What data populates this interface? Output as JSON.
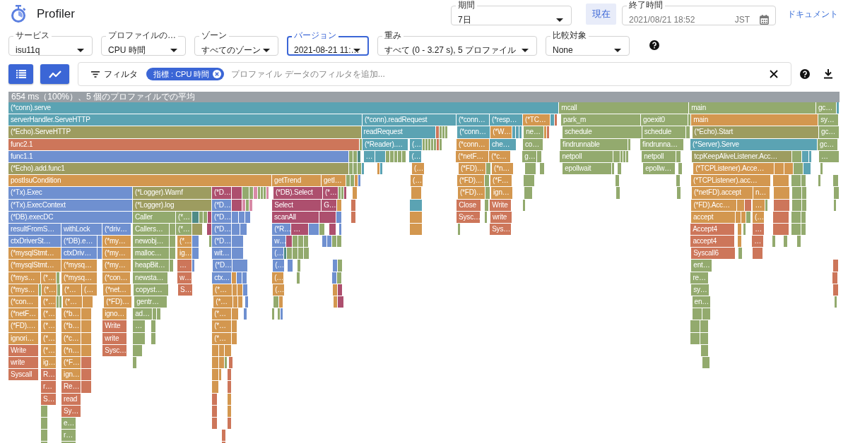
{
  "header": {
    "title": "Profiler",
    "period": {
      "label": "期間",
      "value": "7日"
    },
    "now_button": "現在",
    "end_time": {
      "label": "終了時間",
      "value": "2021/08/21 18:52",
      "timezone": "JST"
    },
    "docs_link": "ドキュメント"
  },
  "selectors": [
    {
      "label": "サービス",
      "value": "isu11q",
      "focused": false
    },
    {
      "label": "プロファイルの…",
      "value": "CPU 時間",
      "focused": false
    },
    {
      "label": "ゾーン",
      "value": "すべてのゾーン",
      "focused": false
    },
    {
      "label": "バージョン",
      "value": "2021-08-21 11:…",
      "focused": true
    },
    {
      "label": "重み",
      "value": "すべて (0 - 3.27 s), 5 プロファイル",
      "focused": false
    },
    {
      "label": "比較対象",
      "value": "None",
      "focused": false
    }
  ],
  "view_buttons": [
    {
      "kind": "list"
    },
    {
      "kind": "chart"
    }
  ],
  "filter_bar": {
    "label": "フィルタ",
    "chips": [
      {
        "text": "指標 : CPU 時間"
      }
    ],
    "placeholder": "プロファイル データのフィルタを追加..."
  },
  "flame_graph": {
    "summary": "654 ms（100%）、5 個のプロファイルでの平均",
    "rows": [
      {
        "frames": [
          {
            "label": "(*conn).serve",
            "color": "#5ba3b3"
          },
          {
            "label": "mcall",
            "color": "#93aa6e"
          },
          {
            "label": "main",
            "color": "#93aa6e"
          },
          {
            "label": "gc…",
            "color": "#93aa6e"
          },
          {
            "color": "#5ba3b3"
          }
        ]
      },
      {
        "frames": [
          {
            "label": "serverHandler.ServeHTTP",
            "color": "#5ba3b3"
          },
          {
            "label": "(*conn).readRequest",
            "color": "#5ba3b3"
          },
          {
            "label": "(*conn…",
            "color": "#5ba3b3"
          },
          {
            "label": "(*resp…",
            "color": "#5ba3b3"
          },
          {
            "label": "(*TC…",
            "color": "#d3974f"
          },
          {
            "color": "#5ba3b3"
          },
          {
            "color": "#cd765a"
          },
          {
            "label": "park_m",
            "color": "#93aa6e"
          },
          {
            "label": "goexit0",
            "color": "#93aa6e"
          },
          {
            "color": "#93aa6e"
          },
          {
            "label": "main",
            "color": "#d3974f"
          },
          {
            "label": "sy…",
            "color": "#93aa6e"
          }
        ]
      },
      {
        "frames": [
          {
            "label": "(*Echo).ServeHTTP",
            "color": "#9d9c60"
          },
          {
            "label": "readRequest",
            "color": "#5ba3b3"
          },
          {
            "color": "#cd765a"
          },
          {
            "color": "#93aa6e"
          },
          {
            "color": "#93aa6e"
          },
          {
            "color": "#93aa6e"
          },
          {
            "label": "(*conn…",
            "color": "#5ba3b3"
          },
          {
            "label": "(*W…",
            "color": "#d3974f"
          },
          {
            "color": "#5ba3b3"
          },
          {
            "color": "#5ba3b3"
          },
          {
            "color": "#5ba3b3"
          },
          {
            "label": "ne…",
            "color": "#93aa6e"
          },
          {
            "color": "#d3974f"
          },
          {
            "color": "#cd765a"
          },
          {
            "label": "schedule",
            "color": "#93aa6e"
          },
          {
            "label": "schedule",
            "color": "#93aa6e"
          },
          {
            "color": "#93aa6e"
          },
          {
            "label": "(*Echo).Start",
            "color": "#9d9c60"
          },
          {
            "label": "gc…",
            "color": "#93aa6e"
          }
        ]
      },
      {
        "frames": [
          {
            "label": "func2.1",
            "color": "#cd765a"
          },
          {
            "color": "#93aa6e"
          },
          {
            "label": "(*Reader).…",
            "color": "#5ba3b3"
          },
          {
            "label": "(…",
            "color": "#5ba3b3"
          },
          {
            "color": "#93aa6e"
          },
          {
            "color": "#93aa6e"
          },
          {
            "color": "#93aa6e"
          },
          {
            "color": "#93aa6e"
          },
          {
            "color": "#93aa6e"
          },
          {
            "color": "#cd765a"
          },
          {
            "color": "#93aa6e"
          },
          {
            "label": "(*conn…",
            "color": "#d3974f"
          },
          {
            "label": "che…",
            "color": "#5ba3b3"
          },
          {
            "label": "co…",
            "color": "#93aa6e"
          },
          {
            "label": "findrunnable",
            "color": "#93aa6e"
          },
          {
            "color": "#93aa6e"
          },
          {
            "label": "findrunna…",
            "color": "#93aa6e"
          },
          {
            "label": "(*Server).Serve",
            "color": "#5ba3b3"
          },
          {
            "label": "gc…",
            "color": "#93aa6e"
          }
        ]
      },
      {
        "frames": [
          {
            "label": "func1.1",
            "color": "#6f90d0"
          },
          {
            "color": "#93aa6e"
          },
          {
            "color": "#93aa6e"
          },
          {
            "color": "#4f8b86"
          },
          {
            "label": "…",
            "color": "#5ba3b3"
          },
          {
            "color": "#5ba3b3"
          },
          {
            "color": "#93aa6e"
          },
          {
            "color": "#93aa6e"
          },
          {
            "color": "#93aa6e"
          },
          {
            "color": "#93aa6e"
          },
          {
            "color": "#93aa6e"
          },
          {
            "label": "(…",
            "color": "#5ba3b3"
          },
          {
            "label": "(*netF…",
            "color": "#d3974f"
          },
          {
            "label": "(*c…",
            "color": "#d3974f"
          },
          {
            "label": "g…",
            "color": "#93aa6e"
          },
          {
            "color": "#93aa6e"
          },
          {
            "label": "netpoll",
            "color": "#93aa6e"
          },
          {
            "color": "#93aa6e"
          },
          {
            "color": "#93aa6e"
          },
          {
            "color": "#93aa6e"
          },
          {
            "color": "#93aa6e"
          },
          {
            "label": "netpoll",
            "color": "#93aa6e"
          },
          {
            "color": "#93aa6e"
          },
          {
            "label": "tcpKeepAliveListener.Acc…",
            "color": "#9d9c60"
          },
          {
            "color": "#93aa6e"
          },
          {
            "color": "#5ba3b3"
          },
          {
            "color": "#5ba3b3"
          },
          {
            "label": "…",
            "color": "#93aa6e"
          }
        ]
      },
      {
        "frames": [
          {
            "label": "(*Echo).add.func1",
            "color": "#9d9c60"
          },
          {
            "color": "#93aa6e"
          },
          {
            "color": "#93aa6e"
          },
          {
            "color": "#93aa6e"
          },
          {
            "color": "#5ba3b3"
          },
          {
            "color": "#d3974f"
          },
          {
            "color": "#5ba3b3"
          },
          {
            "label": "(…",
            "color": "#d3974f"
          },
          {
            "label": "(*FD)…",
            "color": "#d3974f"
          },
          {
            "color": "#93aa6e"
          },
          {
            "label": "(*n…",
            "color": "#d3974f"
          },
          {
            "color": "#93aa6e"
          },
          {
            "color": "#93aa6e"
          },
          {
            "label": "epollwait",
            "color": "#93aa6e"
          },
          {
            "color": "#93aa6e"
          },
          {
            "color": "#93aa6e"
          },
          {
            "label": "epollw…",
            "color": "#93aa6e"
          },
          {
            "color": "#93aa6e"
          },
          {
            "label": "(*TCPListener).Acce…",
            "color": "#d3974f"
          },
          {
            "color": "#d3974f"
          },
          {
            "color": "#d3974f"
          },
          {
            "color": "#93aa6e"
          },
          {
            "color": "#5ba3b3"
          },
          {
            "color": "#93aa6e"
          }
        ]
      },
      {
        "frames": [
          {
            "label": "postIsuCondition",
            "color": "#d3974f"
          },
          {
            "label": "getTrend",
            "color": "#d3974f"
          },
          {
            "label": "getI…",
            "color": "#d3974f"
          },
          {
            "color": "#93aa6e"
          },
          {
            "color": "#93aa6e"
          },
          {
            "color": "#d3974f"
          },
          {
            "color": "#6f90d0"
          },
          {
            "label": "(…",
            "color": "#d3974f"
          },
          {
            "label": "(*FD)…",
            "color": "#d3974f"
          },
          {
            "color": "#93aa6e"
          },
          {
            "label": "(*F…",
            "color": "#d3974f"
          },
          {
            "color": "#93aa6e"
          },
          {
            "color": "#93aa6e"
          },
          {
            "color": "#93aa6e"
          },
          {
            "label": "(*TCPListener).acc…",
            "color": "#d3974f"
          },
          {
            "color": "#d3974f"
          },
          {
            "color": "#93aa6e"
          },
          {
            "color": "#93aa6e"
          },
          {
            "color": "#93aa6e"
          },
          {
            "color": "#93aa6e"
          }
        ]
      },
      {
        "frames": [
          {
            "label": "(*Tx).Exec",
            "color": "#6f90d0"
          },
          {
            "label": "(*Logger).Warnf",
            "color": "#9d9c60"
          },
          {
            "label": "(*D…",
            "color": "#ad4f6e"
          },
          {
            "color": "#ad4f6e"
          },
          {
            "color": "#93aa6e"
          },
          {
            "color": "#93aa6e"
          },
          {
            "color": "#d88aa6"
          },
          {
            "color": "#93aa6e"
          },
          {
            "color": "#93aa6e"
          },
          {
            "color": "#93aa6e"
          },
          {
            "color": "#d88aa6"
          },
          {
            "label": "(*DB).Select",
            "color": "#ad4f6e"
          },
          {
            "label": "(*…",
            "color": "#ad4f6e"
          },
          {
            "color": "#93aa6e"
          },
          {
            "color": "#93aa6e"
          },
          {
            "color": "#ad4f6e"
          },
          {
            "color": "#d3974f"
          },
          {
            "color": "#d3974f"
          },
          {
            "label": "(*FD)…",
            "color": "#d3974f"
          },
          {
            "color": "#93aa6e"
          },
          {
            "label": "ign…",
            "color": "#d3974f"
          },
          {
            "color": "#93aa6e"
          },
          {
            "color": "#93aa6e"
          },
          {
            "color": "#93aa6e"
          },
          {
            "label": "(*netFD).accept",
            "color": "#d3974f"
          },
          {
            "label": "n…",
            "color": "#d3974f"
          },
          {
            "color": "#d3974f"
          },
          {
            "color": "#93aa6e"
          },
          {
            "color": "#93aa6e"
          },
          {
            "color": "#93aa6e"
          }
        ]
      },
      {
        "frames": [
          {
            "label": "(*Tx).ExecContext",
            "color": "#6f90d0"
          },
          {
            "label": "(*Logger).log",
            "color": "#9d9c60"
          },
          {
            "label": "(*D…",
            "color": "#6f90d0"
          },
          {
            "color": "#ad4f6e"
          },
          {
            "color": "#d88aa6"
          },
          {
            "color": "#93aa6e"
          },
          {
            "color": "#d88aa6"
          },
          {
            "label": "Select",
            "color": "#ad4f6e"
          },
          {
            "label": "G…",
            "color": "#ad4f6e"
          },
          {
            "color": "#d3974f"
          },
          {
            "color": "#cd765a"
          },
          {
            "color": "#5ba3b3"
          },
          {
            "label": "Close",
            "color": "#cd765a"
          },
          {
            "color": "#93aa6e"
          },
          {
            "label": "Write",
            "color": "#cd765a"
          },
          {
            "color": "#93aa6e"
          },
          {
            "label": "(*FD).Acc…",
            "color": "#d3974f"
          },
          {
            "color": "#d3974f"
          },
          {
            "color": "#cd765a"
          },
          {
            "label": "…",
            "color": "#d3974f"
          },
          {
            "color": "#93aa6e"
          },
          {
            "color": "#cd765a"
          },
          {
            "color": "#93aa6e"
          },
          {
            "color": "#93aa6e"
          },
          {
            "color": "#93aa6e"
          }
        ]
      },
      {
        "frames": [
          {
            "label": "(*DB).execDC",
            "color": "#6f90d0"
          },
          {
            "label": "Caller",
            "color": "#93aa6e"
          },
          {
            "label": "(*…",
            "color": "#93aa6e"
          },
          {
            "color": "#4f8b86"
          },
          {
            "color": "#93aa6e"
          },
          {
            "color": "#93aa6e"
          },
          {
            "color": "#ad4f6e"
          },
          {
            "label": "(*D…",
            "color": "#6f90d0"
          },
          {
            "color": "#6f90d0"
          },
          {
            "color": "#6f90d0"
          },
          {
            "color": "#6f90d0"
          },
          {
            "label": "scanAll",
            "color": "#ad4f6e"
          },
          {
            "color": "#ad4f6e"
          },
          {
            "color": "#6f90d0"
          },
          {
            "color": "#cd765a"
          },
          {
            "color": "#d3974f"
          },
          {
            "label": "Sysc…",
            "color": "#cd765a"
          },
          {
            "color": "#93aa6e"
          },
          {
            "label": "write",
            "color": "#cd765a"
          },
          {
            "label": "accept",
            "color": "#d3974f"
          },
          {
            "color": "#d3974f"
          },
          {
            "color": "#d3974f"
          },
          {
            "color": "#93aa6e"
          },
          {
            "label": "(…",
            "color": "#d3974f"
          },
          {
            "color": "#cd765a"
          },
          {
            "color": "#93aa6e"
          },
          {
            "color": "#93aa6e"
          }
        ]
      },
      {
        "frames": [
          {
            "label": "resultFromS…",
            "color": "#6f90d0"
          },
          {
            "label": "withLock",
            "color": "#6f90d0"
          },
          {
            "label": "(*driv…",
            "color": "#6f90d0"
          },
          {
            "label": "Callers…",
            "color": "#93aa6e"
          },
          {
            "color": "#93aa6e"
          },
          {
            "label": "(*…",
            "color": "#93aa6e"
          },
          {
            "color": "#9d9c60"
          },
          {
            "color": "#ad4f6e"
          },
          {
            "label": "(*D…",
            "color": "#6f90d0"
          },
          {
            "color": "#6f90d0"
          },
          {
            "color": "#6f90d0"
          },
          {
            "label": "(*R…",
            "color": "#6f90d0"
          },
          {
            "label": "…",
            "color": "#ad4f6e"
          },
          {
            "color": "#6f90d0"
          },
          {
            "color": "#93aa6e"
          },
          {
            "color": "#ad4f6e"
          },
          {
            "color": "#6f90d0"
          },
          {
            "color": "#d3974f"
          },
          {
            "color": "#93aa6e"
          },
          {
            "label": "Sys…",
            "color": "#cd765a"
          },
          {
            "label": "Accept4",
            "color": "#cd765a"
          },
          {
            "color": "#d3974f"
          },
          {
            "color": "#93aa6e"
          },
          {
            "label": "…",
            "color": "#cd765a"
          },
          {
            "color": "#cd765a"
          },
          {
            "color": "#93aa6e"
          },
          {
            "color": "#93aa6e"
          }
        ]
      },
      {
        "frames": [
          {
            "label": "ctxDriverSt…",
            "color": "#6f90d0"
          },
          {
            "label": "(*DB).e…",
            "color": "#6f90d0"
          },
          {
            "color": "#6f90d0"
          },
          {
            "label": "(*my…",
            "color": "#d3974f"
          },
          {
            "label": "newobj…",
            "color": "#93aa6e"
          },
          {
            "color": "#93aa6e"
          },
          {
            "label": "(*…",
            "color": "#d3974f"
          },
          {
            "color": "#6f90d0"
          },
          {
            "color": "#93aa6e"
          },
          {
            "label": "(*D…",
            "color": "#6f90d0"
          },
          {
            "color": "#6f90d0"
          },
          {
            "label": "w…",
            "color": "#6f90d0"
          },
          {
            "color": "#ad4f6e"
          },
          {
            "color": "#93aa6e"
          },
          {
            "color": "#93aa6e"
          },
          {
            "color": "#93aa6e"
          },
          {
            "color": "#6f90d0"
          },
          {
            "color": "#6f90d0"
          },
          {
            "color": "#93aa6e"
          },
          {
            "color": "#93aa6e"
          },
          {
            "label": "accept4",
            "color": "#cd765a"
          },
          {
            "color": "#d3974f"
          },
          {
            "label": "…",
            "color": "#cd765a"
          },
          {
            "color": "#93aa6e"
          },
          {
            "color": "#93aa6e"
          },
          {
            "color": "#93aa6e"
          }
        ]
      },
      {
        "frames": [
          {
            "label": "(*mysqlStmt…",
            "color": "#d3974f"
          },
          {
            "label": "ctxDriv…",
            "color": "#6f90d0"
          },
          {
            "color": "#6f90d0"
          },
          {
            "label": "(*my…",
            "color": "#d3974f"
          },
          {
            "label": "malloc…",
            "color": "#93aa6e"
          },
          {
            "color": "#93aa6e"
          },
          {
            "label": "ig…",
            "color": "#d3974f"
          },
          {
            "color": "#6f90d0"
          },
          {
            "label": "wit…",
            "color": "#6f90d0"
          },
          {
            "color": "#6f90d0"
          },
          {
            "label": "(…",
            "color": "#6f90d0"
          },
          {
            "color": "#4f8b86"
          },
          {
            "color": "#93aa6e"
          },
          {
            "color": "#93aa6e"
          },
          {
            "color": "#93aa6e"
          },
          {
            "color": "#93aa6e"
          },
          {
            "label": "Syscall6",
            "color": "#cd765a"
          },
          {
            "color": "#93aa6e"
          },
          {
            "color": "#cd765a"
          }
        ]
      },
      {
        "frames": [
          {
            "label": "(*mysqlStmt…",
            "color": "#d3974f"
          },
          {
            "label": "(*mysq…",
            "color": "#d3974f"
          },
          {
            "label": "(*my…",
            "color": "#d3974f"
          },
          {
            "label": "heapBit…",
            "color": "#93aa6e"
          },
          {
            "color": "#93aa6e"
          },
          {
            "label": "…",
            "color": "#cd765a"
          },
          {
            "color": "#6f90d0"
          },
          {
            "label": "(*D…",
            "color": "#6f90d0"
          },
          {
            "color": "#6f90d0"
          },
          {
            "label": "(…",
            "color": "#6f90d0"
          },
          {
            "color": "#6f90d0"
          },
          {
            "color": "#93aa6e"
          },
          {
            "color": "#6f90d0"
          },
          {
            "color": "#93aa6e"
          },
          {
            "label": "ent…",
            "color": "#93aa6e"
          },
          {
            "color": "#cd765a"
          }
        ]
      },
      {
        "frames": [
          {
            "label": "(*mys…",
            "color": "#d3974f"
          },
          {
            "label": "(*…",
            "color": "#d3974f"
          },
          {
            "color": "#93aa6e"
          },
          {
            "label": "(*mysq…",
            "color": "#d3974f"
          },
          {
            "label": "(*con…",
            "color": "#d3974f"
          },
          {
            "label": "newsta…",
            "color": "#93aa6e"
          },
          {
            "label": "w…",
            "color": "#cd765a"
          },
          {
            "label": "ctx…",
            "color": "#6f90d0"
          },
          {
            "color": "#d3974f"
          },
          {
            "color": "#6f90d0"
          },
          {
            "color": "#6f90d0"
          },
          {
            "label": "(…",
            "color": "#d3974f"
          },
          {
            "color": "#93aa6e"
          },
          {
            "color": "#6f90d0"
          },
          {
            "color": "#93aa6e"
          },
          {
            "label": "re…",
            "color": "#93aa6e"
          },
          {
            "color": "#cd765a"
          }
        ]
      },
      {
        "frames": [
          {
            "label": "(*mys…",
            "color": "#d3974f"
          },
          {
            "color": "#93aa6e"
          },
          {
            "label": "(*…",
            "color": "#d3974f"
          },
          {
            "color": "#93aa6e"
          },
          {
            "label": "(*…",
            "color": "#d3974f"
          },
          {
            "label": "(…",
            "color": "#d3974f"
          },
          {
            "label": "(*net…",
            "color": "#d3974f"
          },
          {
            "label": "copyst…",
            "color": "#93aa6e"
          },
          {
            "label": "S…",
            "color": "#cd765a"
          },
          {
            "label": "(*…",
            "color": "#d3974f"
          },
          {
            "color": "#d3974f"
          },
          {
            "color": "#d3974f"
          },
          {
            "color": "#6f90d0"
          },
          {
            "label": "(…",
            "color": "#d3974f"
          },
          {
            "color": "#d3974f"
          },
          {
            "color": "#ad4f6e"
          },
          {
            "label": "sy…",
            "color": "#93aa6e"
          },
          {
            "color": "#cd765a"
          }
        ]
      },
      {
        "frames": [
          {
            "label": "(*con…",
            "color": "#d3974f"
          },
          {
            "label": "(*…",
            "color": "#d3974f"
          },
          {
            "color": "#93aa6e"
          },
          {
            "color": "#93aa6e"
          },
          {
            "label": "(*…",
            "color": "#d3974f"
          },
          {
            "color": "#d3974f"
          },
          {
            "label": "(*FD)…",
            "color": "#d3974f"
          },
          {
            "label": "gentr…",
            "color": "#93aa6e"
          },
          {
            "label": "(*…",
            "color": "#d3974f"
          },
          {
            "color": "#d3974f"
          },
          {
            "color": "#d3974f"
          },
          {
            "color": "#6f90d0"
          },
          {
            "color": "#93aa6e"
          },
          {
            "color": "#d3974f"
          },
          {
            "color": "#d3974f"
          },
          {
            "color": "#ad4f6e"
          },
          {
            "label": "en…",
            "color": "#93aa6e"
          },
          {
            "color": "#93aa6e"
          }
        ]
      },
      {
        "frames": [
          {
            "label": "(*netF…",
            "color": "#d3974f"
          },
          {
            "label": "(*…",
            "color": "#d3974f"
          },
          {
            "label": "(*b…",
            "color": "#d3974f"
          },
          {
            "color": "#d3974f"
          },
          {
            "label": "igno…",
            "color": "#d3974f"
          },
          {
            "label": "ad…",
            "color": "#93aa6e"
          },
          {
            "color": "#93aa6e"
          },
          {
            "color": "#93aa6e"
          },
          {
            "label": "(*…",
            "color": "#d3974f"
          },
          {
            "color": "#d3974f"
          },
          {
            "color": "#6f90d0"
          },
          {
            "color": "#93aa6e"
          },
          {
            "color": "#93aa6e"
          },
          {
            "color": "#6f90d0"
          },
          {
            "color": "#93aa6e"
          },
          {
            "color": "#93aa6e"
          }
        ]
      },
      {
        "frames": [
          {
            "label": "(*FD).…",
            "color": "#d3974f"
          },
          {
            "label": "(*…",
            "color": "#d3974f"
          },
          {
            "label": "(*b…",
            "color": "#d3974f"
          },
          {
            "color": "#d3974f"
          },
          {
            "label": "Write",
            "color": "#cd765a"
          },
          {
            "label": "…",
            "color": "#93aa6e"
          },
          {
            "color": "#93aa6e"
          },
          {
            "label": "(*…",
            "color": "#d3974f"
          },
          {
            "color": "#d3974f"
          },
          {
            "color": "#93aa6e"
          },
          {
            "color": "#93aa6e"
          }
        ]
      },
      {
        "frames": [
          {
            "label": "ignori…",
            "color": "#d3974f"
          },
          {
            "label": "(*…",
            "color": "#d3974f"
          },
          {
            "label": "(*c…",
            "color": "#d3974f"
          },
          {
            "color": "#d3974f"
          },
          {
            "label": "write",
            "color": "#cd765a"
          },
          {
            "color": "#93aa6e"
          },
          {
            "color": "#93aa6e"
          },
          {
            "label": "(*…",
            "color": "#d3974f"
          },
          {
            "color": "#d3974f"
          },
          {
            "color": "#93aa6e"
          },
          {
            "color": "#93aa6e"
          }
        ]
      },
      {
        "frames": [
          {
            "label": "Write",
            "color": "#cd765a"
          },
          {
            "label": "(*…",
            "color": "#d3974f"
          },
          {
            "label": "(*n…",
            "color": "#d3974f"
          },
          {
            "color": "#d3974f"
          },
          {
            "label": "Sysc…",
            "color": "#cd765a"
          },
          {
            "color": "#93aa6e"
          },
          {
            "color": "#d3974f"
          },
          {
            "color": "#d3974f"
          },
          {
            "color": "#d3974f"
          },
          {
            "color": "#93aa6e"
          }
        ]
      },
      {
        "frames": [
          {
            "label": "write",
            "color": "#cd765a"
          },
          {
            "label": "ig…",
            "color": "#d3974f"
          },
          {
            "label": "(*F…",
            "color": "#d3974f"
          },
          {
            "color": "#cd765a"
          },
          {
            "color": "#93aa6e"
          },
          {
            "color": "#d3974f"
          },
          {
            "color": "#d3974f"
          },
          {
            "color": "#93aa6e"
          },
          {
            "color": "#cd765a"
          },
          {
            "color": "#93aa6e"
          }
        ]
      },
      {
        "frames": [
          {
            "label": "Syscall",
            "color": "#cd765a"
          },
          {
            "label": "R…",
            "color": "#cd765a"
          },
          {
            "label": "ign…",
            "color": "#d3974f"
          },
          {
            "color": "#cd765a"
          },
          {
            "color": "#d3974f"
          },
          {
            "color": "#d3974f"
          },
          {
            "color": "#cd765a"
          }
        ]
      },
      {
        "frames": [
          {
            "label": "r…",
            "color": "#cd765a"
          },
          {
            "label": "Re…",
            "color": "#cd765a"
          },
          {
            "color": "#cd765a"
          },
          {
            "color": "#d3974f"
          },
          {
            "color": "#cd765a"
          }
        ]
      },
      {
        "frames": [
          {
            "label": "S…",
            "color": "#cd765a"
          },
          {
            "label": "read",
            "color": "#cd765a"
          },
          {
            "color": "#cd765a"
          },
          {
            "color": "#d3974f"
          }
        ]
      },
      {
        "frames": [
          {
            "color": "#93aa6e"
          },
          {
            "label": "Sy…",
            "color": "#cd765a"
          },
          {
            "color": "#cd765a"
          },
          {
            "color": "#d3974f"
          }
        ]
      },
      {
        "frames": [
          {
            "color": "#93aa6e"
          },
          {
            "label": "e…",
            "color": "#93aa6e"
          },
          {
            "color": "#cd765a"
          },
          {
            "color": "#cd765a"
          }
        ]
      },
      {
        "frames": [
          {
            "color": "#93aa6e"
          },
          {
            "label": "r…",
            "color": "#93aa6e"
          },
          {
            "color": "#cd765a"
          }
        ]
      },
      {
        "frames": [
          {
            "color": "#93aa6e"
          },
          {
            "color": "#93aa6e"
          },
          {
            "color": "#cd765a"
          }
        ]
      }
    ]
  }
}
